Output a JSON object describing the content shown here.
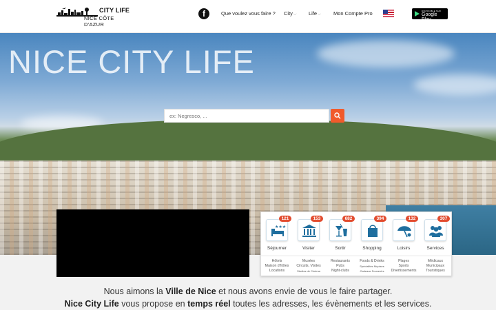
{
  "header": {
    "logo_line1": "CITY LIFE",
    "logo_line2": "NICE CÔTE D'AZUR",
    "facebook_letter": "f",
    "nav": [
      {
        "label": "Que voulez vous faire ?",
        "dropdown": false
      },
      {
        "label": "City",
        "dropdown": true
      },
      {
        "label": "Life",
        "dropdown": true
      },
      {
        "label": "Mon Compte Pro",
        "dropdown": false
      }
    ],
    "language_flag": "us-flag",
    "google_play_top": "DISPONIBLE SUR",
    "google_play_main": "Google Play"
  },
  "hero": {
    "title": "NICE CITY LIFE",
    "search_placeholder": "ex: Negresco, ..."
  },
  "categories": [
    {
      "label": "Séjourner",
      "count": "121",
      "icon": "hotel-bed-icon",
      "sub": [
        "Hôtels",
        "Maison d'hôtes",
        "Locations"
      ],
      "small": []
    },
    {
      "label": "Visiter",
      "count": "153",
      "icon": "museum-icon",
      "sub": [
        "Musées",
        "Circuits, Visites"
      ],
      "small": [
        "Studios de Cinéma"
      ]
    },
    {
      "label": "Sortir",
      "count": "682",
      "icon": "cocktail-icon",
      "sub": [
        "Restaurants",
        "Pubs",
        "Night-clubs"
      ],
      "small": []
    },
    {
      "label": "Shopping",
      "count": "394",
      "icon": "shopping-bag-icon",
      "sub": [
        "Foods & Drinks"
      ],
      "small": [
        "Spécialités Niçoises",
        "Cadeaux Souvenirs"
      ]
    },
    {
      "label": "Loisirs",
      "count": "132",
      "icon": "beach-umbrella-icon",
      "sub": [
        "Plages",
        "Sports",
        "Divertissements"
      ],
      "small": []
    },
    {
      "label": "Services",
      "count": "307",
      "icon": "people-icon",
      "sub": [
        "Médicaux",
        "Municipaux",
        "Touristiques"
      ],
      "small": []
    }
  ],
  "intro": {
    "l1_a": "Nous aimons la ",
    "l1_b": "Ville de Nice",
    "l1_c": " et nous avons envie de vous le faire partager.",
    "l2_a": "Nice City Life",
    "l2_b": " vous propose en ",
    "l2_c": "temps réel",
    "l2_d": " toutes les adresses, les évènements et les services."
  },
  "colors": {
    "accent": "#f15a2b",
    "badge": "#e24c2f",
    "icon_blue": "#1f6e9e"
  }
}
